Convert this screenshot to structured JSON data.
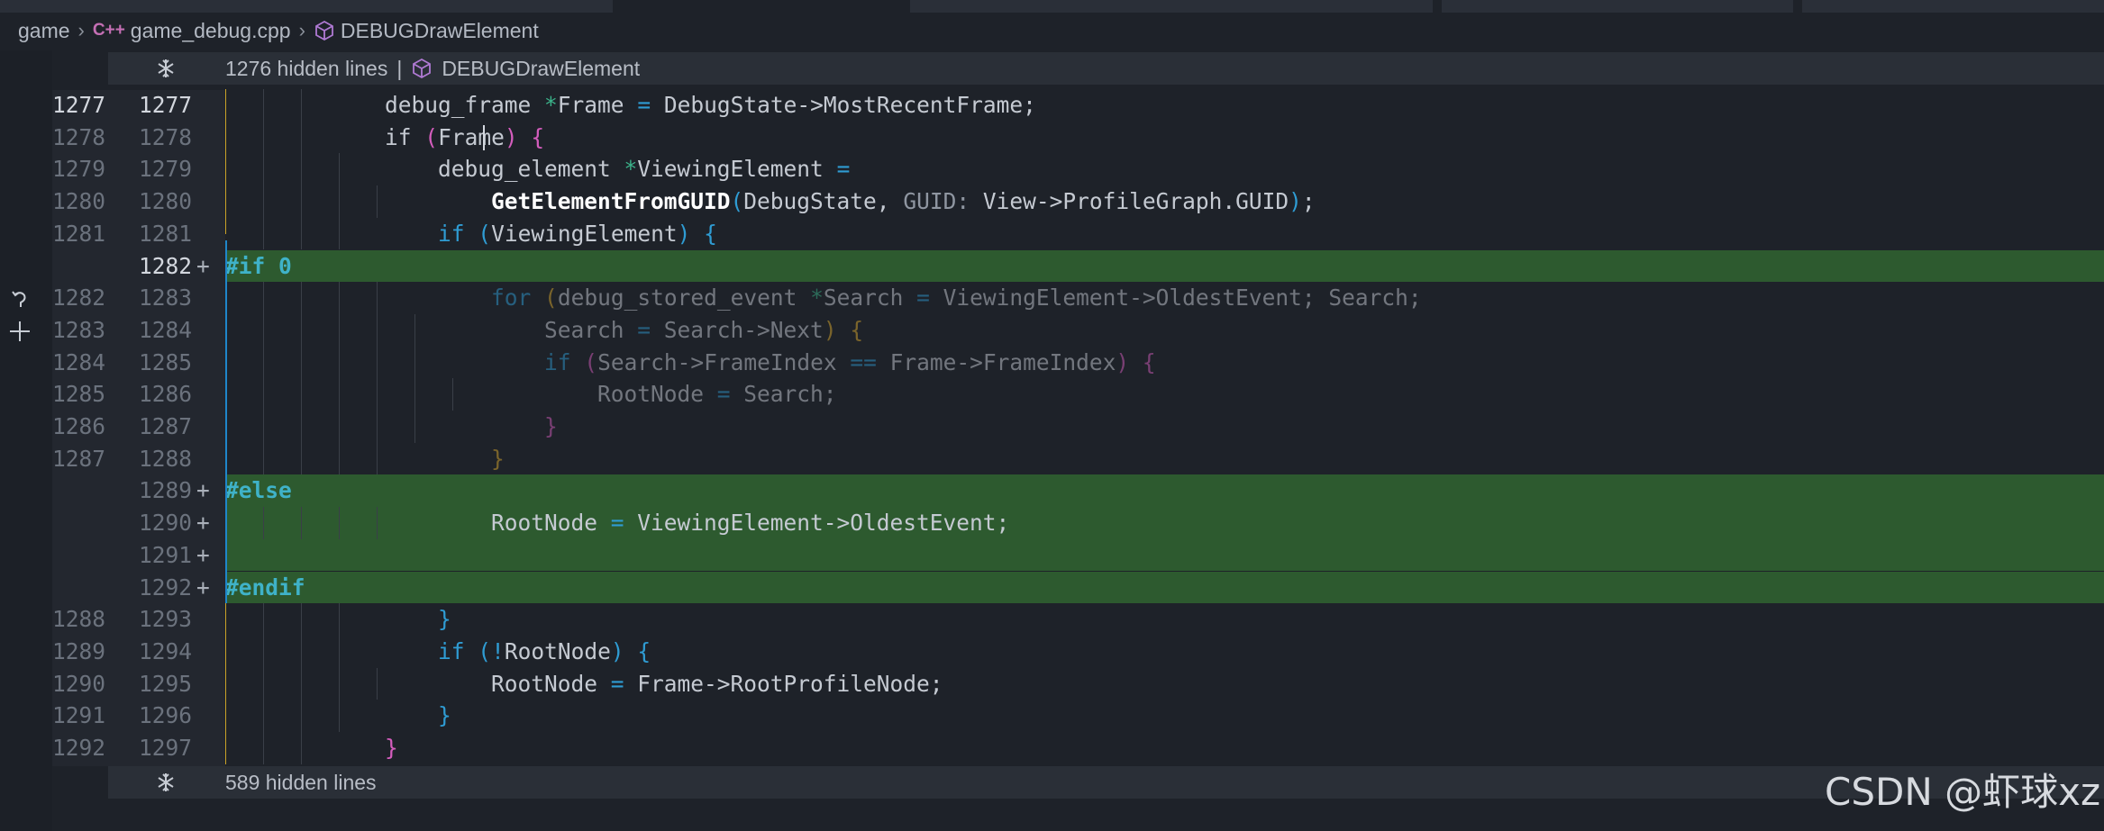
{
  "breadcrumb": {
    "folder": "game",
    "lang_badge": "C++",
    "file": "game_debug.cpp",
    "symbol": "DEBUGDrawElement",
    "icons": [
      "chevron-right-icon",
      "cube-icon"
    ]
  },
  "fold_top": {
    "count_label": "1276 hidden lines",
    "separator": "|",
    "symbol": "DEBUGDrawElement"
  },
  "fold_bottom": {
    "count_label": "589 hidden lines"
  },
  "watermark": "CSDN @虾球xz",
  "colors": {
    "added_bg": "#2d5a2f",
    "keyword": "#2f9cd3",
    "preprocessor": "#3fb2c8"
  },
  "lines": [
    {
      "old": "1277",
      "new": "1277",
      "added": false,
      "cur": true,
      "tokens": [
        {
          "t": "            ",
          "c": ""
        },
        {
          "t": "debug_frame ",
          "c": "k-type"
        },
        {
          "t": "*",
          "c": "k-ptr"
        },
        {
          "t": "Frame ",
          "c": "k-type"
        },
        {
          "t": "=",
          "c": "k-op"
        },
        {
          "t": " DebugState->MostRecentFrame;",
          "c": "k-type"
        }
      ]
    },
    {
      "old": "1278",
      "new": "1278",
      "added": false,
      "tokens": [
        {
          "t": "            ",
          "c": ""
        },
        {
          "t": "if",
          "c": "k-type"
        },
        {
          "t": " ",
          "c": ""
        },
        {
          "t": "(",
          "c": "p-pink"
        },
        {
          "t": "Frame",
          "c": "k-type"
        },
        {
          "t": ")",
          "c": "p-pink"
        },
        {
          "t": " ",
          "c": ""
        },
        {
          "t": "{",
          "c": "p-pink"
        }
      ]
    },
    {
      "old": "1279",
      "new": "1279",
      "added": false,
      "tokens": [
        {
          "t": "                ",
          "c": ""
        },
        {
          "t": "debug_element ",
          "c": "k-type"
        },
        {
          "t": "*",
          "c": "k-ptr"
        },
        {
          "t": "ViewingElement ",
          "c": "k-type"
        },
        {
          "t": "=",
          "c": "k-op"
        }
      ]
    },
    {
      "old": "1280",
      "new": "1280",
      "added": false,
      "tokens": [
        {
          "t": "                    ",
          "c": ""
        },
        {
          "t": "GetElementFromGUID",
          "c": "k-fn"
        },
        {
          "t": "(",
          "c": "p-blue"
        },
        {
          "t": "DebugState, ",
          "c": "k-type"
        },
        {
          "t": "GUID:",
          "c": "k-hint"
        },
        {
          "t": " View->ProfileGraph.GUID",
          "c": "k-type"
        },
        {
          "t": ")",
          "c": "p-blue"
        },
        {
          "t": ";",
          "c": "k-type"
        }
      ]
    },
    {
      "old": "1281",
      "new": "1281",
      "added": false,
      "tokens": [
        {
          "t": "                ",
          "c": ""
        },
        {
          "t": "if",
          "c": "k-kw"
        },
        {
          "t": " ",
          "c": ""
        },
        {
          "t": "(",
          "c": "p-blue"
        },
        {
          "t": "ViewingElement",
          "c": "k-type"
        },
        {
          "t": ")",
          "c": "p-blue"
        },
        {
          "t": " ",
          "c": ""
        },
        {
          "t": "{",
          "c": "p-blue"
        }
      ]
    },
    {
      "old": "",
      "new": "1282",
      "added": true,
      "cur": true,
      "tokens": [
        {
          "t": "#if",
          "c": "k-pp"
        },
        {
          "t": " ",
          "c": ""
        },
        {
          "t": "0",
          "c": "k-num"
        }
      ]
    },
    {
      "old": "1282",
      "new": "1283",
      "added": false,
      "dim": true,
      "tokens": [
        {
          "t": "                    ",
          "c": ""
        },
        {
          "t": "for",
          "c": "k-kw"
        },
        {
          "t": " ",
          "c": ""
        },
        {
          "t": "(",
          "c": "p-gold"
        },
        {
          "t": "debug_stored_event ",
          "c": "k-type"
        },
        {
          "t": "*",
          "c": "k-ptr"
        },
        {
          "t": "Search ",
          "c": "k-type"
        },
        {
          "t": "=",
          "c": "k-op"
        },
        {
          "t": " ViewingElement->OldestEvent; Search;",
          "c": "k-type"
        }
      ]
    },
    {
      "old": "1283",
      "new": "1284",
      "added": false,
      "dim": true,
      "tokens": [
        {
          "t": "                        ",
          "c": ""
        },
        {
          "t": "Search ",
          "c": "k-type"
        },
        {
          "t": "=",
          "c": "k-op"
        },
        {
          "t": " Search->Next",
          "c": "k-type"
        },
        {
          "t": ")",
          "c": "p-gold"
        },
        {
          "t": " ",
          "c": ""
        },
        {
          "t": "{",
          "c": "p-gold"
        }
      ]
    },
    {
      "old": "1284",
      "new": "1285",
      "added": false,
      "dim": true,
      "tokens": [
        {
          "t": "                        ",
          "c": ""
        },
        {
          "t": "if",
          "c": "k-kw"
        },
        {
          "t": " ",
          "c": ""
        },
        {
          "t": "(",
          "c": "p-pink"
        },
        {
          "t": "Search->FrameIndex ",
          "c": "k-type"
        },
        {
          "t": "==",
          "c": "k-op"
        },
        {
          "t": " Frame->FrameIndex",
          "c": "k-type"
        },
        {
          "t": ")",
          "c": "p-pink"
        },
        {
          "t": " ",
          "c": ""
        },
        {
          "t": "{",
          "c": "p-pink"
        }
      ]
    },
    {
      "old": "1285",
      "new": "1286",
      "added": false,
      "dim": true,
      "tokens": [
        {
          "t": "                            ",
          "c": ""
        },
        {
          "t": "RootNode ",
          "c": "k-type"
        },
        {
          "t": "=",
          "c": "k-op"
        },
        {
          "t": " Search;",
          "c": "k-type"
        }
      ]
    },
    {
      "old": "1286",
      "new": "1287",
      "added": false,
      "dim": true,
      "tokens": [
        {
          "t": "                        ",
          "c": ""
        },
        {
          "t": "}",
          "c": "p-pink"
        }
      ]
    },
    {
      "old": "1287",
      "new": "1288",
      "added": false,
      "dim": true,
      "tokens": [
        {
          "t": "                    ",
          "c": ""
        },
        {
          "t": "}",
          "c": "p-gold"
        }
      ]
    },
    {
      "old": "",
      "new": "1289",
      "added": true,
      "tokens": [
        {
          "t": "#else",
          "c": "k-pp"
        }
      ]
    },
    {
      "old": "",
      "new": "1290",
      "added": true,
      "tokens": [
        {
          "t": "                    ",
          "c": ""
        },
        {
          "t": "RootNode ",
          "c": "k-type"
        },
        {
          "t": "=",
          "c": "k-op"
        },
        {
          "t": " ViewingElement->OldestEvent;",
          "c": "k-type"
        }
      ]
    },
    {
      "old": "",
      "new": "1291",
      "added": true,
      "tokens": []
    },
    {
      "old": "",
      "new": "1292",
      "added": true,
      "tokens": [
        {
          "t": "#endif",
          "c": "k-pp"
        }
      ]
    },
    {
      "old": "1288",
      "new": "1293",
      "added": false,
      "tokens": [
        {
          "t": "                ",
          "c": ""
        },
        {
          "t": "}",
          "c": "p-blue"
        }
      ]
    },
    {
      "old": "1289",
      "new": "1294",
      "added": false,
      "tokens": [
        {
          "t": "                ",
          "c": ""
        },
        {
          "t": "if",
          "c": "k-kw"
        },
        {
          "t": " ",
          "c": ""
        },
        {
          "t": "(",
          "c": "p-blue"
        },
        {
          "t": "!",
          "c": "k-op"
        },
        {
          "t": "RootNode",
          "c": "k-type"
        },
        {
          "t": ")",
          "c": "p-blue"
        },
        {
          "t": " ",
          "c": ""
        },
        {
          "t": "{",
          "c": "p-blue"
        }
      ]
    },
    {
      "old": "1290",
      "new": "1295",
      "added": false,
      "tokens": [
        {
          "t": "                    ",
          "c": ""
        },
        {
          "t": "RootNode ",
          "c": "k-type"
        },
        {
          "t": "=",
          "c": "k-op"
        },
        {
          "t": " Frame->RootProfileNode;",
          "c": "k-type"
        }
      ]
    },
    {
      "old": "1291",
      "new": "1296",
      "added": false,
      "tokens": [
        {
          "t": "                ",
          "c": ""
        },
        {
          "t": "}",
          "c": "p-blue"
        }
      ]
    },
    {
      "old": "1292",
      "new": "1297",
      "added": false,
      "tokens": [
        {
          "t": "            ",
          "c": ""
        },
        {
          "t": "}",
          "c": "p-pink"
        }
      ]
    }
  ]
}
